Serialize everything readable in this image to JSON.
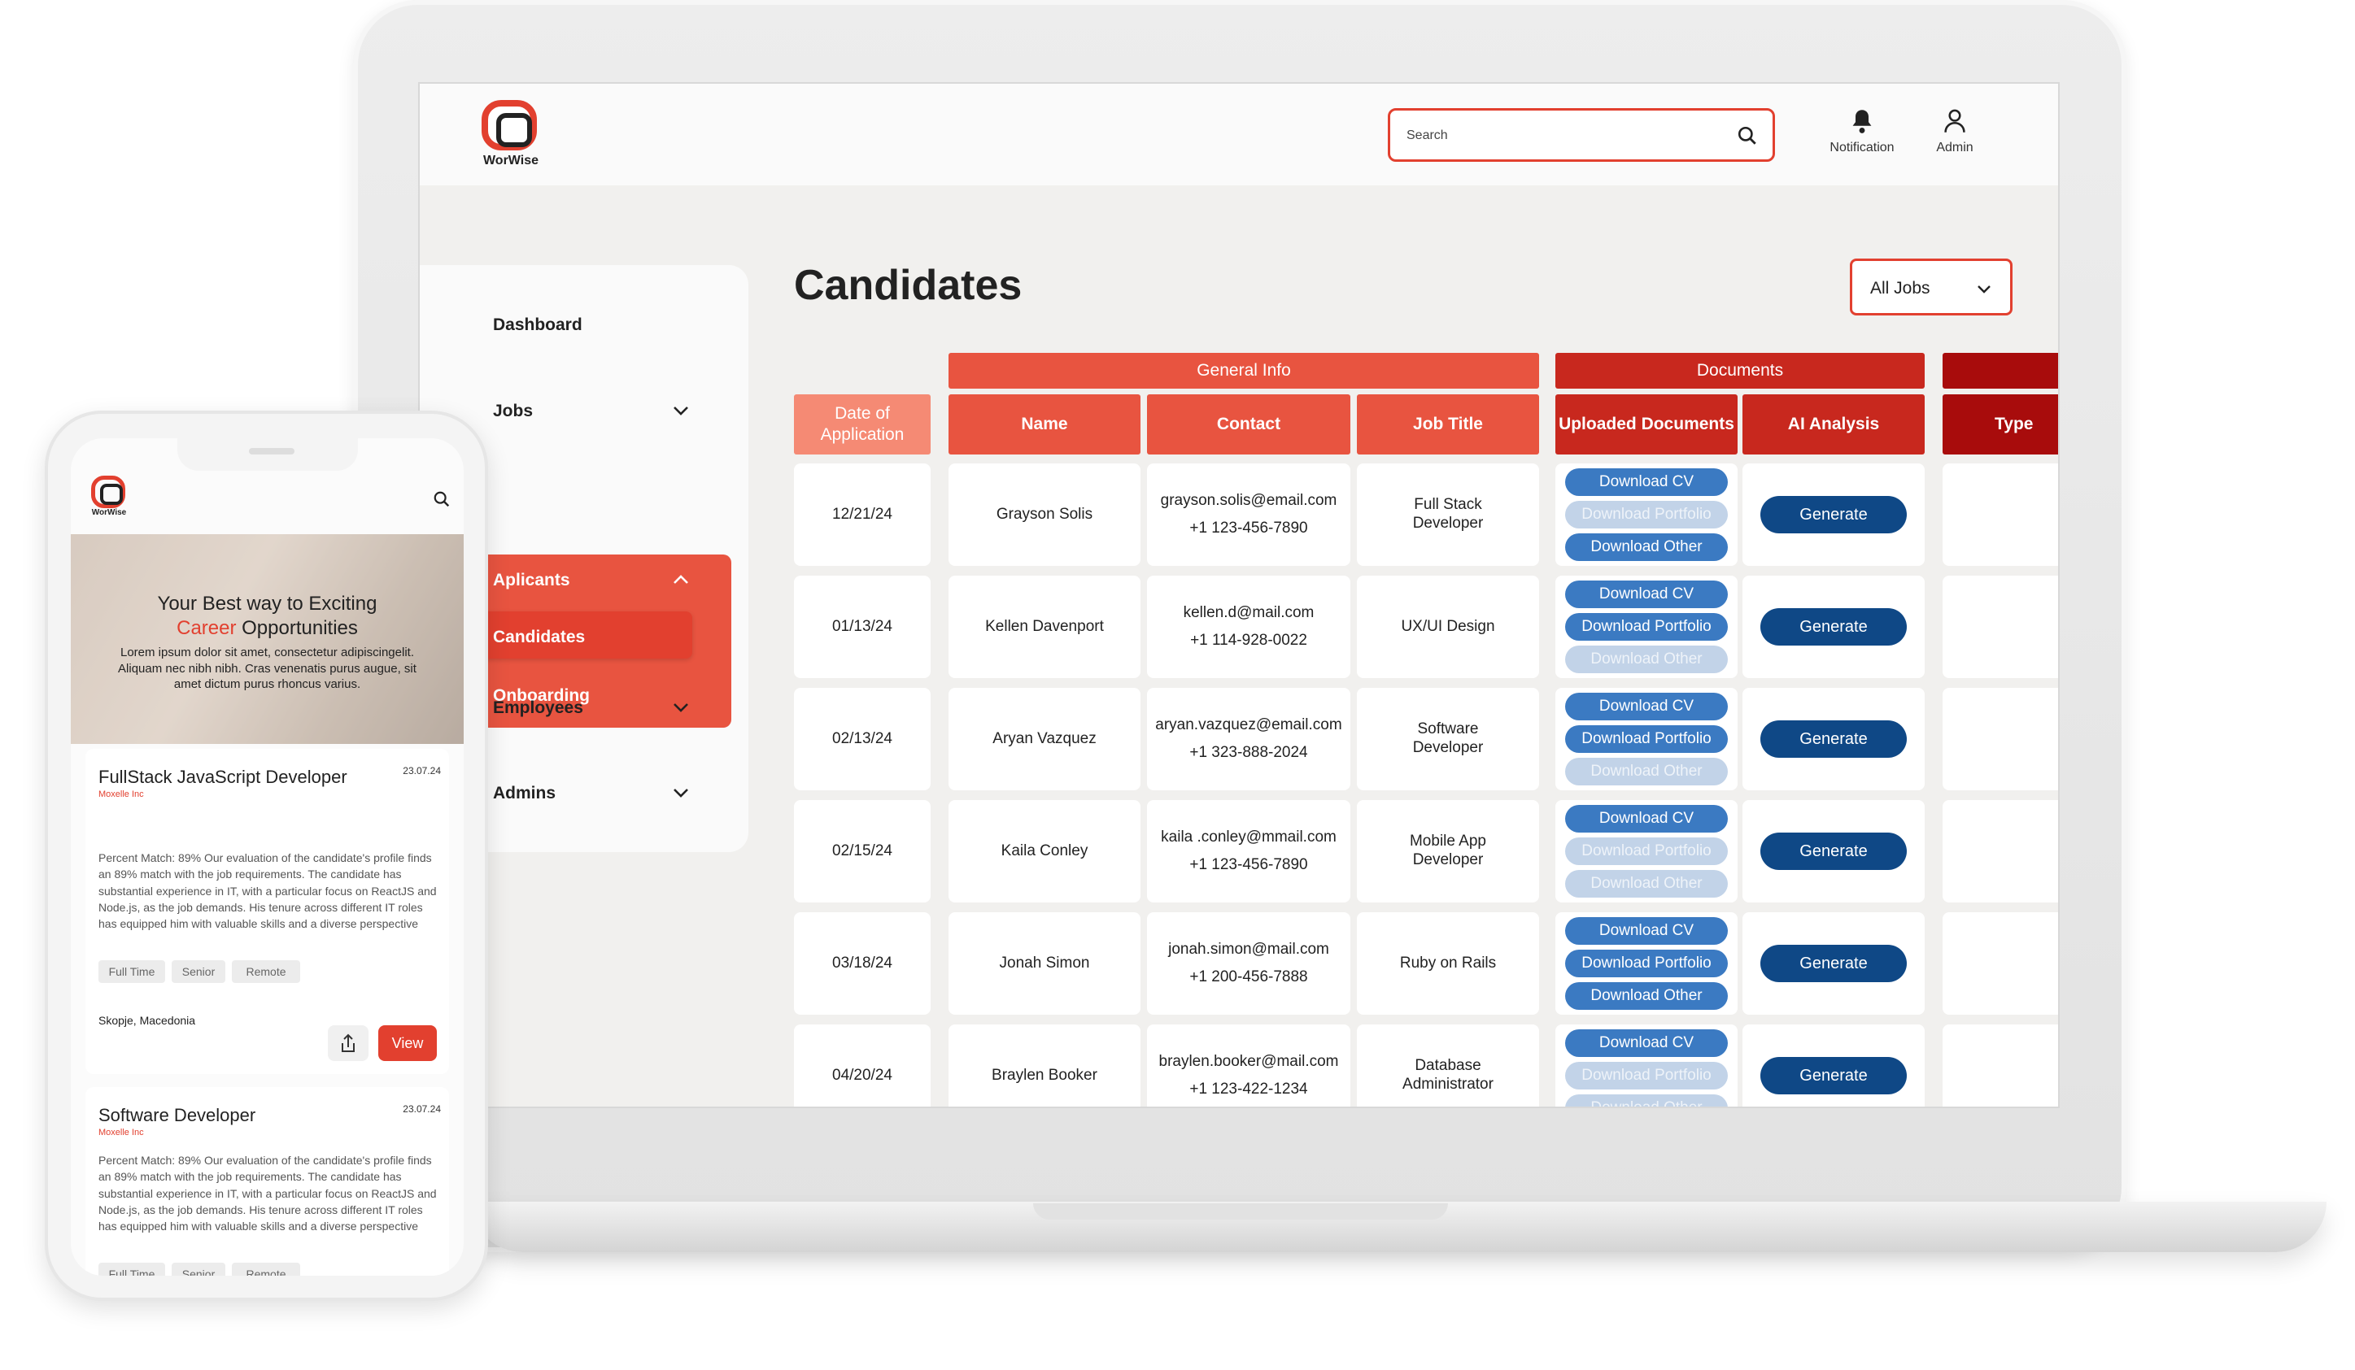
{
  "app": {
    "logo_text": "WorWise"
  },
  "topbar": {
    "search_placeholder": "Search",
    "notification_label": "Notification",
    "admin_label": "Admin"
  },
  "sidebar": {
    "dashboard": "Dashboard",
    "jobs": "Jobs",
    "applicants": "Aplicants",
    "candidates": "Candidates",
    "onboarding": "Onboarding",
    "employees": "Employees",
    "admins": "Admins"
  },
  "main": {
    "title": "Candidates",
    "filter_value": "All Jobs",
    "groups": {
      "general": "General Info",
      "documents": "Documents"
    },
    "headers": {
      "date": "Date of Application",
      "name": "Name",
      "contact": "Contact",
      "job_title": "Job Title",
      "uploaded": "Uploaded Documents",
      "ai": "AI Analysis",
      "type": "Type"
    },
    "buttons": {
      "cv": "Download CV",
      "portfolio": "Download Portfolio",
      "other": "Download Other",
      "generate": "Generate"
    },
    "rows": [
      {
        "date": "12/21/24",
        "name": "Grayson Solis",
        "email": "grayson.solis@email.com",
        "phone": "+1 123-456-7890",
        "job": "Full Stack Developer",
        "cv": true,
        "portfolio": false,
        "other": true
      },
      {
        "date": "01/13/24",
        "name": "Kellen Davenport",
        "email": "kellen.d@mail.com",
        "phone": "+1 114-928-0022",
        "job": "UX/UI Design",
        "cv": true,
        "portfolio": true,
        "other": false
      },
      {
        "date": "02/13/24",
        "name": "Aryan Vazquez",
        "email": "aryan.vazquez@email.com",
        "phone": "+1 323-888-2024",
        "job": "Software Developer",
        "cv": true,
        "portfolio": true,
        "other": false
      },
      {
        "date": "02/15/24",
        "name": "Kaila Conley",
        "email": "kaila .conley@mmail.com",
        "phone": "+1 123-456-7890",
        "job": "Mobile App Developer",
        "cv": true,
        "portfolio": false,
        "other": false
      },
      {
        "date": "03/18/24",
        "name": "Jonah Simon",
        "email": "jonah.simon@mail.com",
        "phone": "+1 200-456-7888",
        "job": "Ruby on Rails",
        "cv": true,
        "portfolio": true,
        "other": true
      },
      {
        "date": "04/20/24",
        "name": "Braylen Booker",
        "email": "braylen.booker@mail.com",
        "phone": "+1 123-422-1234",
        "job": "Database Administrator",
        "cv": true,
        "portfolio": false,
        "other": false
      }
    ]
  },
  "mobile": {
    "logo_text": "WorWise",
    "hero_line1": "Your Best way to Exciting",
    "hero_highlight": "Career",
    "hero_line2_rest": " Opportunities",
    "hero_body": "Lorem ipsum dolor sit amet, consectetur adipiscingelit. Aliquam nec nibh nibh. Cras venenatis purus augue, sit amet dictum purus rhoncus varius.",
    "jobs": [
      {
        "title": "FullStack JavaScript Developer",
        "company": "Moxelle Inc",
        "date": "23.07.24",
        "desc": "Percent Match: 89% Our evaluation of the candidate's profile finds an 89% match with the job requirements. The candidate has substantial experience in IT, with a particular focus on ReactJS and Node.js, as the job demands. His tenure across different IT roles has equipped him with valuable skills and a diverse perspective",
        "tags": [
          "Full Time",
          "Senior",
          "Remote"
        ],
        "location": "Skopje, Macedonia",
        "view_label": "View"
      },
      {
        "title": "Software Developer",
        "company": "Moxelle Inc",
        "date": "23.07.24",
        "desc": "Percent Match: 89% Our evaluation of the candidate's profile finds an 89% match with the job requirements. The candidate has substantial experience in IT, with a particular focus on ReactJS and Node.js, as the job demands. His tenure across different IT roles has equipped him with valuable skills and a diverse perspective",
        "tags": [
          "Full Time",
          "Senior",
          "Remote"
        ]
      }
    ]
  },
  "colors": {
    "accent": "#e2402f",
    "accent_light": "#f58a74",
    "accent_mid": "#e85440",
    "accent_dark": "#c8281e",
    "accent_darkest": "#a80c0c",
    "button_blue": "#3b7ac2",
    "button_navy": "#0f4886"
  }
}
